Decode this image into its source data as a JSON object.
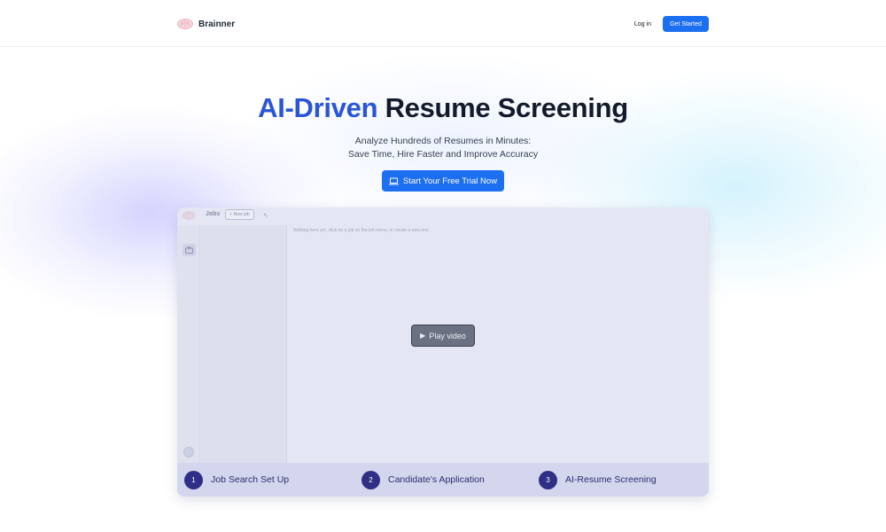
{
  "header": {
    "brand_name": "Brainner",
    "login_label": "Log in",
    "get_started_label": "Get Started"
  },
  "hero": {
    "title_accent": "AI-Driven",
    "title_rest": "Resume Screening",
    "subtitle_line1": "Analyze Hundreds of Resumes in Minutes:",
    "subtitle_line2": "Save Time, Hire Faster and Improve Accuracy",
    "cta_label": "Start Your Free Trial Now"
  },
  "app_preview": {
    "jobs_label": "Jobs",
    "new_job_label": "+ New job",
    "empty_message": "Nothing here yet, click on a job on the left menu, or create a new one.",
    "play_label": "Play video",
    "steps": [
      {
        "number": "1",
        "label": "Job Search Set Up"
      },
      {
        "number": "2",
        "label": "Candidate's Application"
      },
      {
        "number": "3",
        "label": "AI-Resume Screening"
      }
    ]
  },
  "colors": {
    "accent": "#2a55d6",
    "primary_button": "#1d6ff2",
    "step_circle": "#2f2f85"
  },
  "icons": {
    "brand": "brain-icon",
    "cta": "laptop-icon",
    "play": "play-icon",
    "rail": "briefcase-icon"
  }
}
